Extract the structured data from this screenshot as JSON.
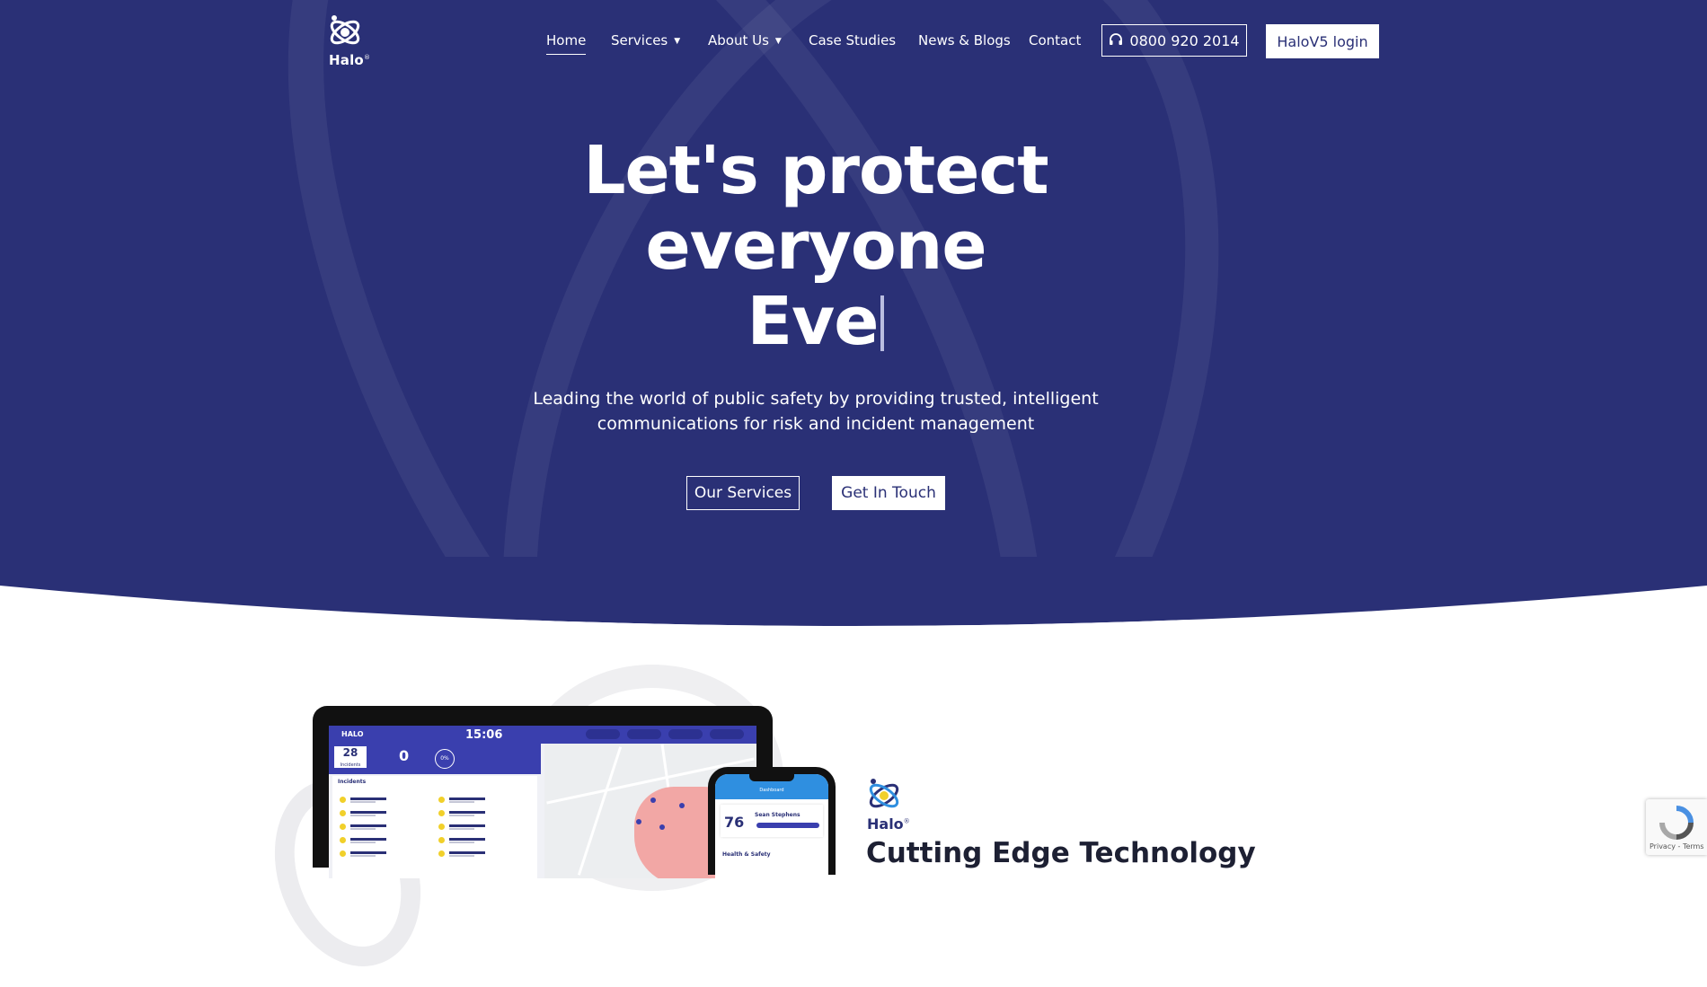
{
  "logo": {
    "text": "Halo",
    "mark": "®"
  },
  "nav": {
    "items": [
      {
        "label": "Home",
        "active": true
      },
      {
        "label": "Services",
        "dropdown": true
      },
      {
        "label": "About Us",
        "dropdown": true
      },
      {
        "label": "Case Studies"
      },
      {
        "label": "News & Blogs"
      },
      {
        "label": "Contact"
      }
    ],
    "phone": {
      "icon": "headset-icon",
      "label": "0800 920 2014"
    },
    "login_label": "HaloV5 login"
  },
  "hero": {
    "headline_line1": "Let's protect",
    "headline_line2": "everyone",
    "headline_typed": "Eve",
    "subtitle_line1": "Leading the world of public safety by providing trusted, intelligent",
    "subtitle_line2": "communications for risk and incident management",
    "buttons": {
      "services": "Our Services",
      "touch": "Get In Touch"
    }
  },
  "dashboard": {
    "brand": "HALO",
    "time": "15:06",
    "incidents_count": "28",
    "incidents_label": "Incidents",
    "zero_value": "0",
    "percent": "0%",
    "list_header": "Incidents",
    "phone_title": "Dashboard",
    "phone_number": "76",
    "phone_name": "Sean Stephens",
    "phone_item": "Health & Safety"
  },
  "section": {
    "logo_text": "Halo",
    "logo_mark": "®",
    "title": "Cutting Edge Technology"
  },
  "recaptcha": {
    "text": "Privacy - Terms"
  },
  "colors": {
    "brand_navy": "#2a3076",
    "white": "#ffffff",
    "accent_blue": "#3a3fae",
    "accent_yellow": "#f1d02a"
  }
}
